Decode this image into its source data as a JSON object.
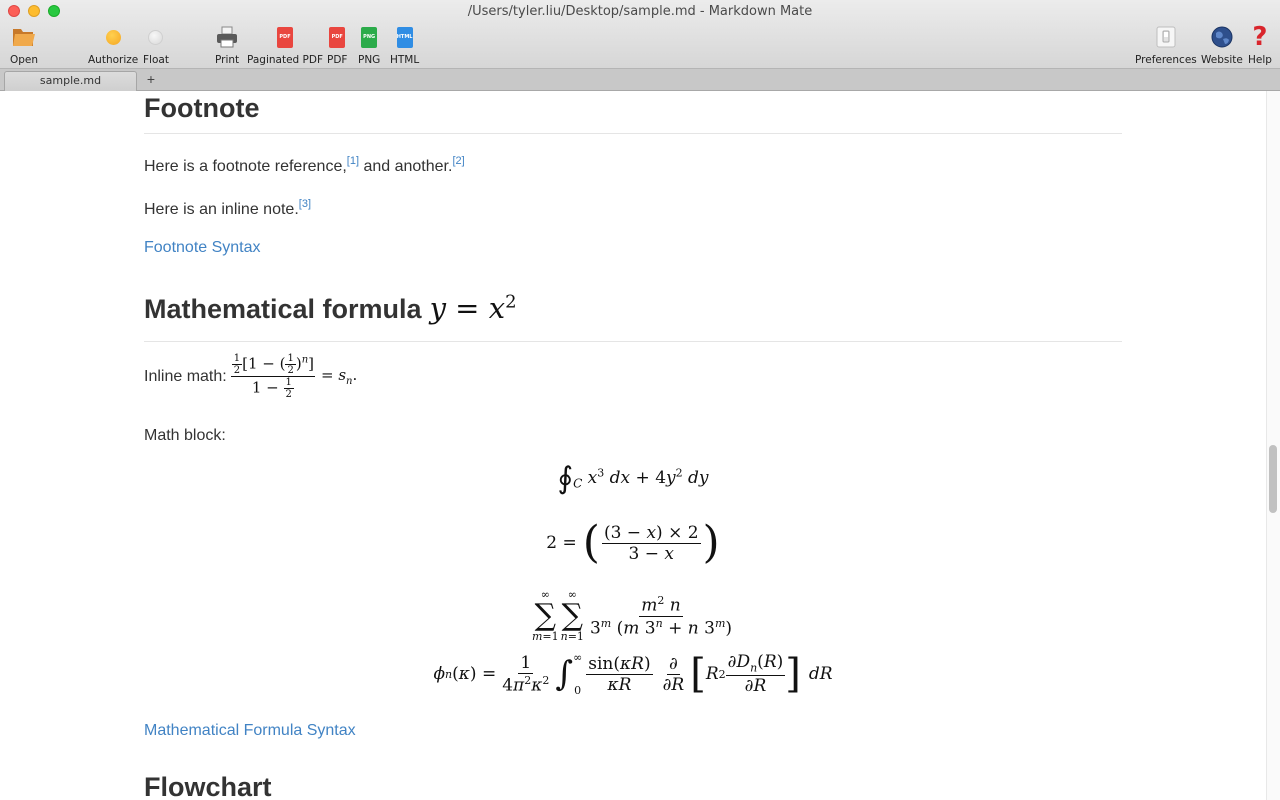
{
  "window": {
    "title": "/Users/tyler.liu/Desktop/sample.md - Markdown Mate"
  },
  "toolbar": {
    "open": "Open",
    "authorize": "Authorize",
    "float": "Float",
    "print": "Print",
    "paginated_pdf": "Paginated PDF",
    "pdf": "PDF",
    "png": "PNG",
    "html": "HTML",
    "preferences": "Preferences",
    "website": "Website",
    "help": "Help",
    "icon_badges": {
      "pdf": "PDF",
      "png": "PNG",
      "html": "HTML"
    }
  },
  "tabs": {
    "active": "sample.md",
    "add": "+"
  },
  "content": {
    "footnote_heading": "Footnote",
    "footnote_para1": "Here is a footnote reference,",
    "footnote_ref1": "[1]",
    "footnote_para1_mid": " and another.",
    "footnote_ref2": "[2]",
    "footnote_para2": "Here is an inline note.",
    "footnote_ref3": "[3]",
    "footnote_link": "Footnote Syntax",
    "math_heading": "Mathematical formula",
    "inline_math_label": "Inline math: ",
    "math_block_label": "Math block:",
    "math_link": "Mathematical Formula Syntax",
    "flowchart_heading": "Flowchart"
  },
  "colors": {
    "link": "#4183c4",
    "heading": "#333333"
  }
}
